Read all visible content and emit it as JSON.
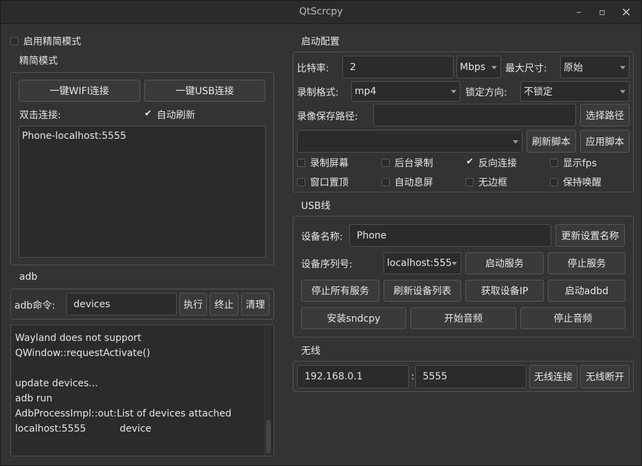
{
  "window": {
    "title": "QtScrcpy",
    "minimize_glyph": "–",
    "maximize_glyph": "▫",
    "close_glyph": "×"
  },
  "simple_mode_toggle": {
    "label": "启用精简模式",
    "checked": false
  },
  "simple_mode": {
    "title": "精简模式",
    "wifi_button": "一键WIFI连接",
    "usb_button": "一键USB连接",
    "double_click_label": "双击连接:",
    "auto_refresh": {
      "label": "自动刷新",
      "checked": true
    },
    "devices": [
      "Phone-localhost:5555"
    ]
  },
  "adb": {
    "title": "adb",
    "command_label": "adb命令:",
    "command_value": "devices",
    "execute_button": "执行",
    "stop_button": "终止",
    "clear_button": "清理",
    "log_lines": [
      "Wayland does not support",
      "QWindow::requestActivate()",
      "",
      "update devices...",
      "adb run",
      "AdbProcessImpl::out:List of devices attached",
      "localhost:5555           device"
    ]
  },
  "startup": {
    "title": "启动配置",
    "bitrate_label": "比特率:",
    "bitrate_value": "2",
    "bitrate_unit": "Mbps",
    "max_size_label": "最大尺寸:",
    "max_size_value": "原始",
    "record_format_label": "录制格式:",
    "record_format_value": "mp4",
    "lock_orientation_label": "锁定方向:",
    "lock_orientation_value": "不锁定",
    "record_path_label": "录像保存路径:",
    "record_path_value": "",
    "choose_path_button": "选择路径",
    "script_value": "",
    "refresh_script_button": "刷新脚本",
    "apply_script_button": "应用脚本",
    "options": [
      {
        "label": "录制屏幕",
        "checked": false
      },
      {
        "label": "后台录制",
        "checked": false
      },
      {
        "label": "反向连接",
        "checked": true
      },
      {
        "label": "显示fps",
        "checked": false
      },
      {
        "label": "窗口置顶",
        "checked": false
      },
      {
        "label": "自动息屏",
        "checked": false
      },
      {
        "label": "无边框",
        "checked": false
      },
      {
        "label": "保持唤醒",
        "checked": false
      }
    ]
  },
  "usb": {
    "title": "USB线",
    "device_name_label": "设备名称:",
    "device_name_value": "Phone",
    "update_name_button": "更新设置名称",
    "serial_label": "设备序列号:",
    "serial_value": "localhost:555",
    "start_service_button": "启动服务",
    "stop_service_button": "停止服务",
    "stop_all_button": "停止所有服务",
    "refresh_devices_button": "刷新设备列表",
    "get_ip_button": "获取设备IP",
    "start_adbd_button": "启动adbd",
    "install_sndcpy_button": "安装sndcpy",
    "start_audio_button": "开始音频",
    "stop_audio_button": "停止音频"
  },
  "wireless": {
    "title": "无线",
    "ip_value": "192.168.0.1",
    "separator": ":",
    "port_value": "5555",
    "connect_button": "无线连接",
    "disconnect_button": "无线断开"
  }
}
